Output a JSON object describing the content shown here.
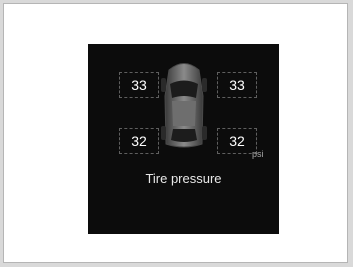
{
  "display": {
    "title": "Tire pressure",
    "unit": "psi",
    "tires": {
      "front_left": "33",
      "front_right": "33",
      "rear_left": "32",
      "rear_right": "32"
    }
  },
  "colors": {
    "page_background": "#d9d9d9",
    "screen_background": "#0c0c0c",
    "text": "#ffffff"
  }
}
